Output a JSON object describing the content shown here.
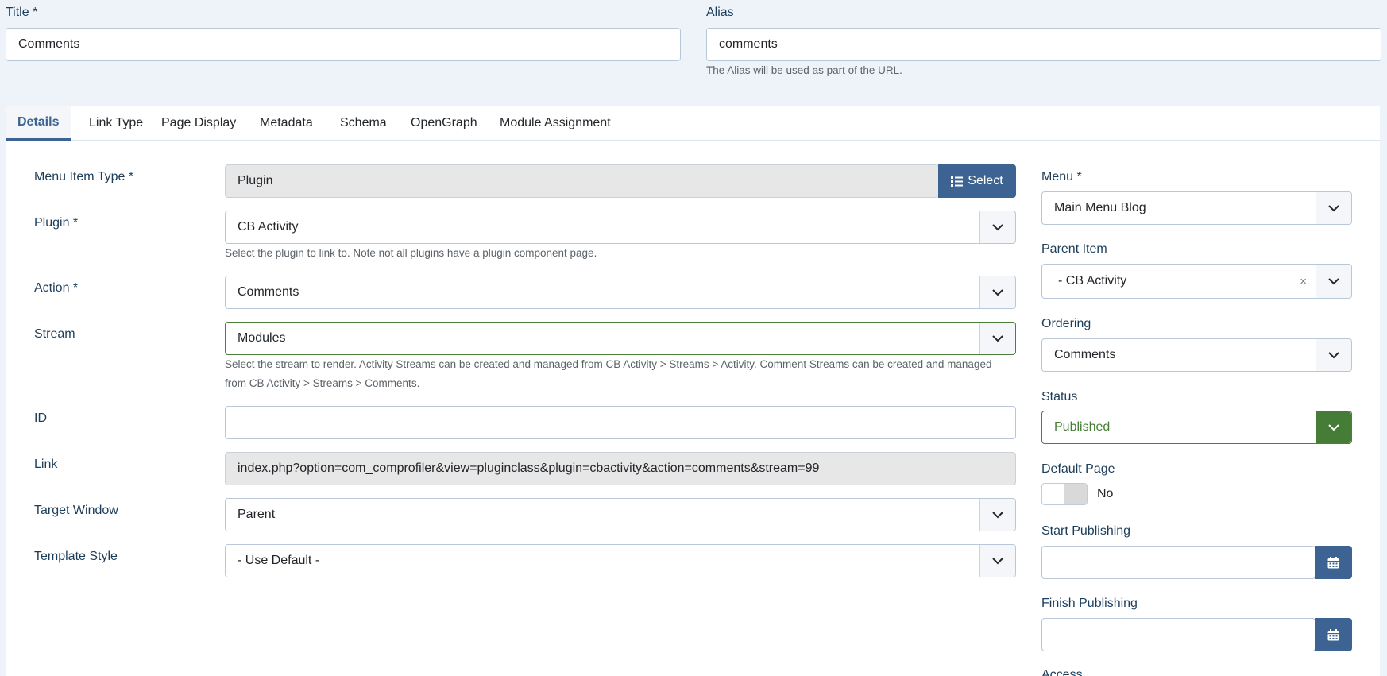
{
  "title": {
    "label": "Title *",
    "value": "Comments"
  },
  "alias": {
    "label": "Alias",
    "value": "comments",
    "help": "The Alias will be used as part of the URL."
  },
  "tabs": [
    {
      "label": "Details",
      "active": true
    },
    {
      "label": "Link Type"
    },
    {
      "label": "Page Display"
    },
    {
      "label": "Metadata"
    },
    {
      "label": "Schema"
    },
    {
      "label": "OpenGraph"
    },
    {
      "label": "Module Assignment"
    }
  ],
  "form": {
    "menu_item_type": {
      "label": "Menu Item Type *",
      "value": "Plugin",
      "button": "Select"
    },
    "plugin": {
      "label": "Plugin *",
      "value": "CB Activity",
      "help": "Select the plugin to link to. Note not all plugins have a plugin component page."
    },
    "action": {
      "label": "Action *",
      "value": "Comments"
    },
    "stream": {
      "label": "Stream",
      "value": "Modules",
      "help": "Select the stream to render. Activity Streams can be created and managed from CB Activity > Streams > Activity. Comment Streams can be created and managed from CB Activity > Streams > Comments."
    },
    "id": {
      "label": "ID",
      "value": ""
    },
    "link": {
      "label": "Link",
      "value": "index.php?option=com_comprofiler&view=pluginclass&plugin=cbactivity&action=comments&stream=99"
    },
    "target_window": {
      "label": "Target Window",
      "value": "Parent"
    },
    "template_style": {
      "label": "Template Style",
      "value": "- Use Default -"
    }
  },
  "sidebar": {
    "menu": {
      "label": "Menu *",
      "value": "Main Menu Blog"
    },
    "parent_item": {
      "label": "Parent Item",
      "value": "- CB Activity",
      "clear": "×"
    },
    "ordering": {
      "label": "Ordering",
      "value": "Comments"
    },
    "status": {
      "label": "Status",
      "value": "Published"
    },
    "default_page": {
      "label": "Default Page",
      "value": "No"
    },
    "start_publishing": {
      "label": "Start Publishing",
      "value": ""
    },
    "finish_publishing": {
      "label": "Finish Publishing",
      "value": ""
    },
    "access": {
      "label": "Access"
    }
  },
  "colors": {
    "accent": "#3d6392",
    "success": "#457d37",
    "background": "#eef3fa"
  },
  "icons": {
    "select_button": "list-icon",
    "dropdown": "chevron-down-icon",
    "calendar": "calendar-icon"
  }
}
